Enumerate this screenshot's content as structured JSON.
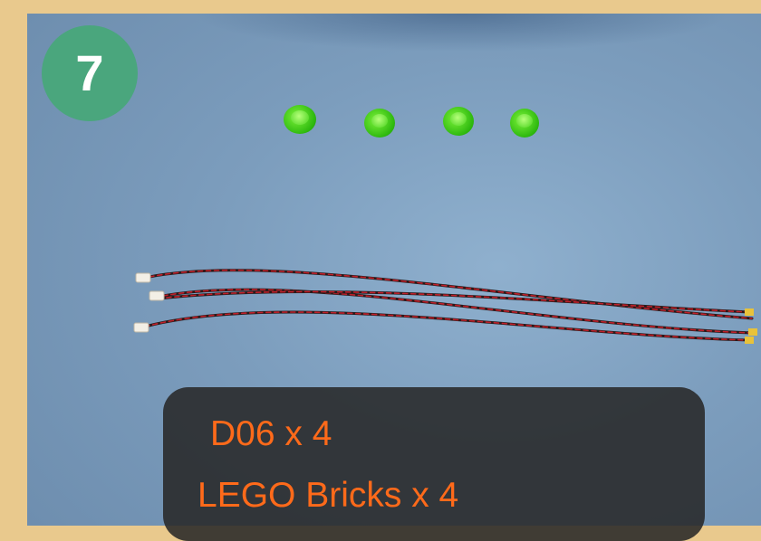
{
  "step": {
    "number": "7"
  },
  "caption": {
    "line1": "D06 x 4",
    "line2": "LEGO Bricks x 4"
  },
  "colors": {
    "frame": "#e9c98d",
    "badge": "#4aa67d",
    "caption_text": "#ff6a1a",
    "caption_bg": "#282828",
    "brick_green": "#3fd21a"
  },
  "icons": {
    "bricks": "green-lego-brick-icon",
    "wires": "led-wire-icon"
  }
}
